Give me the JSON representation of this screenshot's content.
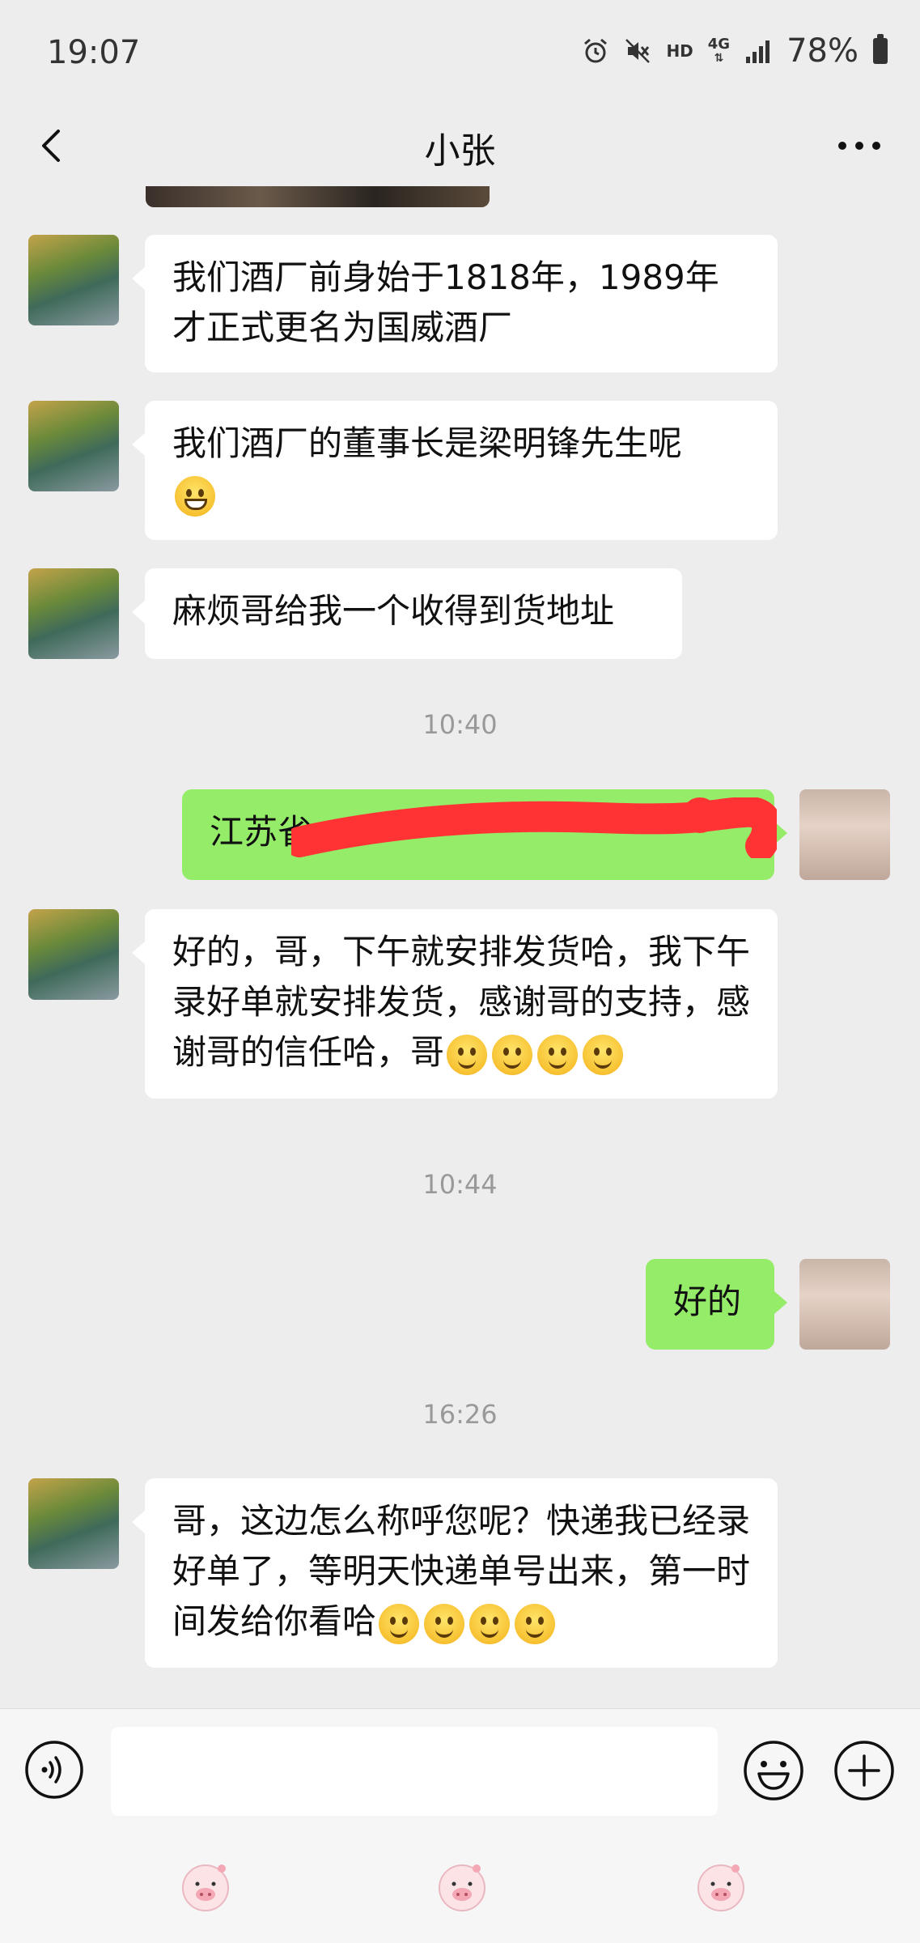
{
  "status_bar": {
    "time": "19:07",
    "hd": "HD",
    "network": "4G",
    "battery": "78%"
  },
  "header": {
    "title": "小张"
  },
  "messages": [
    {
      "type": "text",
      "from": "other",
      "text": "我们酒厂前身始于1818年，1989年才正式更名为国威酒厂"
    },
    {
      "type": "text",
      "from": "other",
      "text": "我们酒厂的董事长是梁明锋先生呢",
      "emoji": [
        "grin"
      ]
    },
    {
      "type": "text",
      "from": "other",
      "text": "麻烦哥给我一个收得到货地址"
    },
    {
      "type": "time",
      "text": "10:40"
    },
    {
      "type": "text",
      "from": "self",
      "text": "江苏省",
      "redacted": true
    },
    {
      "type": "text",
      "from": "other",
      "text": "好的，哥，下午就安排发货哈，我下午录好单就安排发货，感谢哥的支持，感谢哥的信任哈，哥",
      "emoji": [
        "smile",
        "smile",
        "smile",
        "smile"
      ]
    },
    {
      "type": "time",
      "text": "10:44"
    },
    {
      "type": "text",
      "from": "self",
      "text": "好的"
    },
    {
      "type": "time",
      "text": "16:26"
    },
    {
      "type": "text",
      "from": "other",
      "text": "哥，这边怎么称呼您呢？快递我已经录好单了，等明天快递单号出来，第一时间发给你看哈",
      "emoji": [
        "smile",
        "smile",
        "smile",
        "smile"
      ]
    }
  ],
  "input": {
    "value": "",
    "placeholder": ""
  },
  "icons": {
    "back": "chevron-left-icon",
    "more": "more-dots-icon",
    "voice": "voice-icon",
    "emoji": "emoji-icon",
    "plus": "plus-icon"
  },
  "colors": {
    "background": "#ededed",
    "self_bubble": "#95ec69",
    "other_bubble": "#ffffff",
    "redaction": "#ff3333"
  }
}
